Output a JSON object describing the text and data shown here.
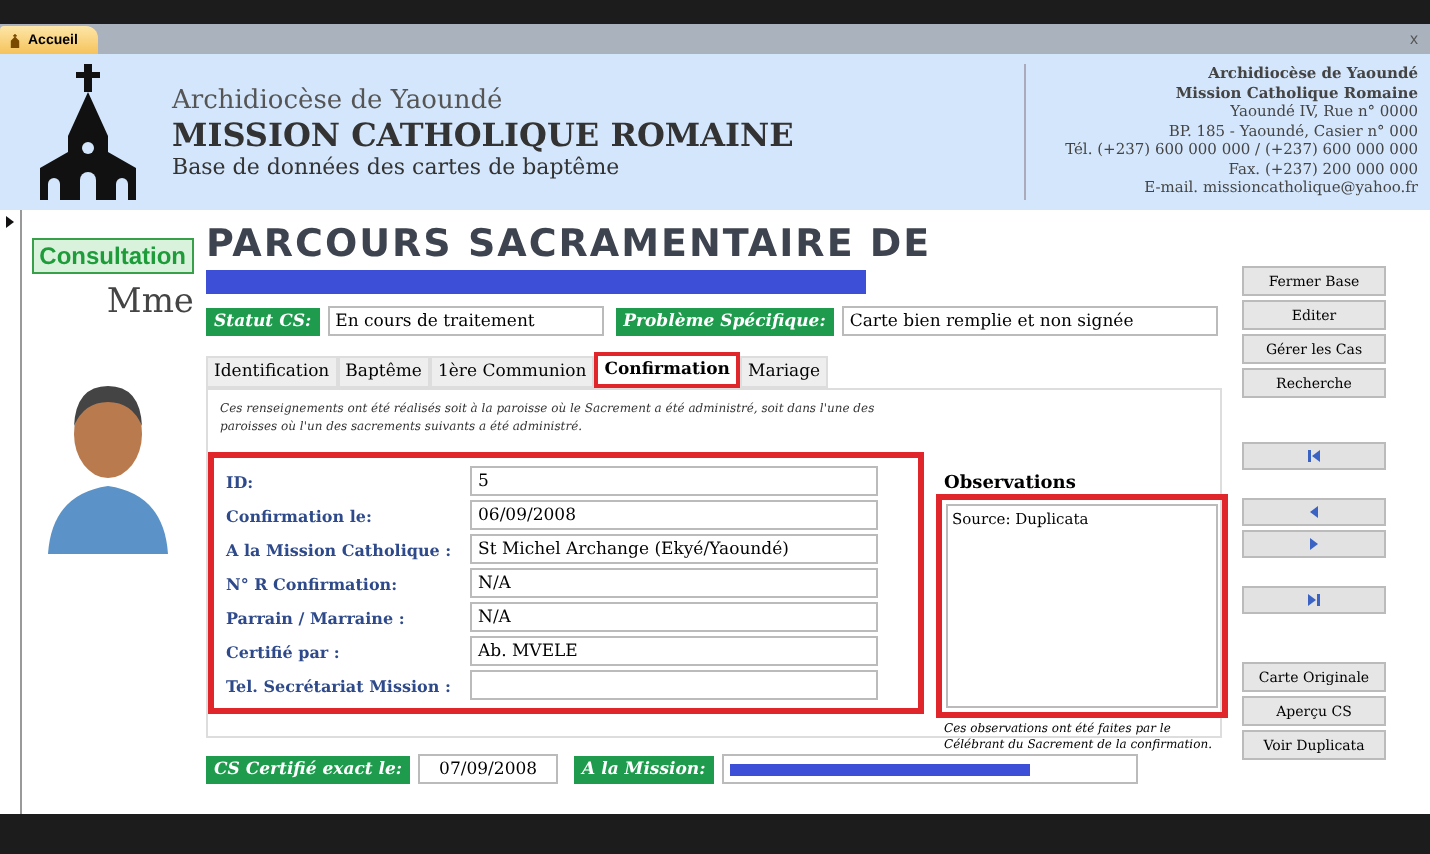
{
  "document_tab": {
    "label": "Accueil",
    "close": "x"
  },
  "header": {
    "diocese": "Archidiocèse de Yaoundé",
    "title": "MISSION CATHOLIQUE ROMAINE",
    "subtitle": "Base de données des cartes de baptême",
    "contact": [
      "Archidiocèse de Yaoundé",
      "Mission Catholique Romaine",
      "Yaoundé IV, Rue n° 0000",
      "BP. 185 - Yaoundé, Casier n° 000",
      "Tél. (+237) 600 000 000 / (+237) 600 000 000",
      "Fax. (+237) 200 000 000",
      "E-mail. missioncatholique@yahoo.fr"
    ]
  },
  "mode_badge": "Consultation",
  "page_title": "PARCOURS SACRAMENTAIRE DE",
  "salutation": "Mme",
  "status": [
    {
      "label": "Statut CS:",
      "value": "En cours de traitement"
    },
    {
      "label": "Problème Spécifique:",
      "value": "Carte bien remplie et non signée"
    }
  ],
  "tabs": [
    {
      "label": "Identification",
      "selected": false
    },
    {
      "label": "Baptême",
      "selected": false
    },
    {
      "label": "1ère Communion",
      "selected": false
    },
    {
      "label": "Confirmation",
      "selected": true
    },
    {
      "label": "Mariage",
      "selected": false
    }
  ],
  "note": "Ces renseignements ont été réalisés soit à la paroisse où le Sacrement a été administré, soit dans l'une des paroisses où l'un des sacrements suivants a été administré.",
  "fields": [
    {
      "label": "ID:",
      "value": "5"
    },
    {
      "label": "Confirmation le:",
      "value": "06/09/2008"
    },
    {
      "label": "A la Mission Catholique :",
      "value": "St Michel Archange (Ekyé/Yaoundé)"
    },
    {
      "label": "N° R Confirmation:",
      "value": "N/A"
    },
    {
      "label": "Parrain / Marraine :",
      "value": "N/A"
    },
    {
      "label": "Certifié par :",
      "value": "Ab. MVELE"
    },
    {
      "label": "Tel. Secrétariat Mission :"
    }
  ],
  "observations": {
    "label": "Observations",
    "value": "Source: Duplicata",
    "note": "Ces observations ont été faites par le Célébrant du Sacrement de la confirmation."
  },
  "footer": [
    {
      "label": "CS Certifié exact le:",
      "value": "07/09/2008"
    },
    {
      "label": "A la Mission:"
    }
  ],
  "actions_top": [
    "Fermer Base",
    "Editer",
    "Gérer les Cas",
    "Recherche"
  ],
  "nav": [
    {
      "kind": "first"
    },
    {
      "kind": "prev"
    },
    {
      "kind": "next"
    },
    {
      "kind": "last"
    }
  ],
  "actions_bottom": [
    "Carte Originale",
    "Aperçu CS",
    "Voir Duplicata"
  ]
}
